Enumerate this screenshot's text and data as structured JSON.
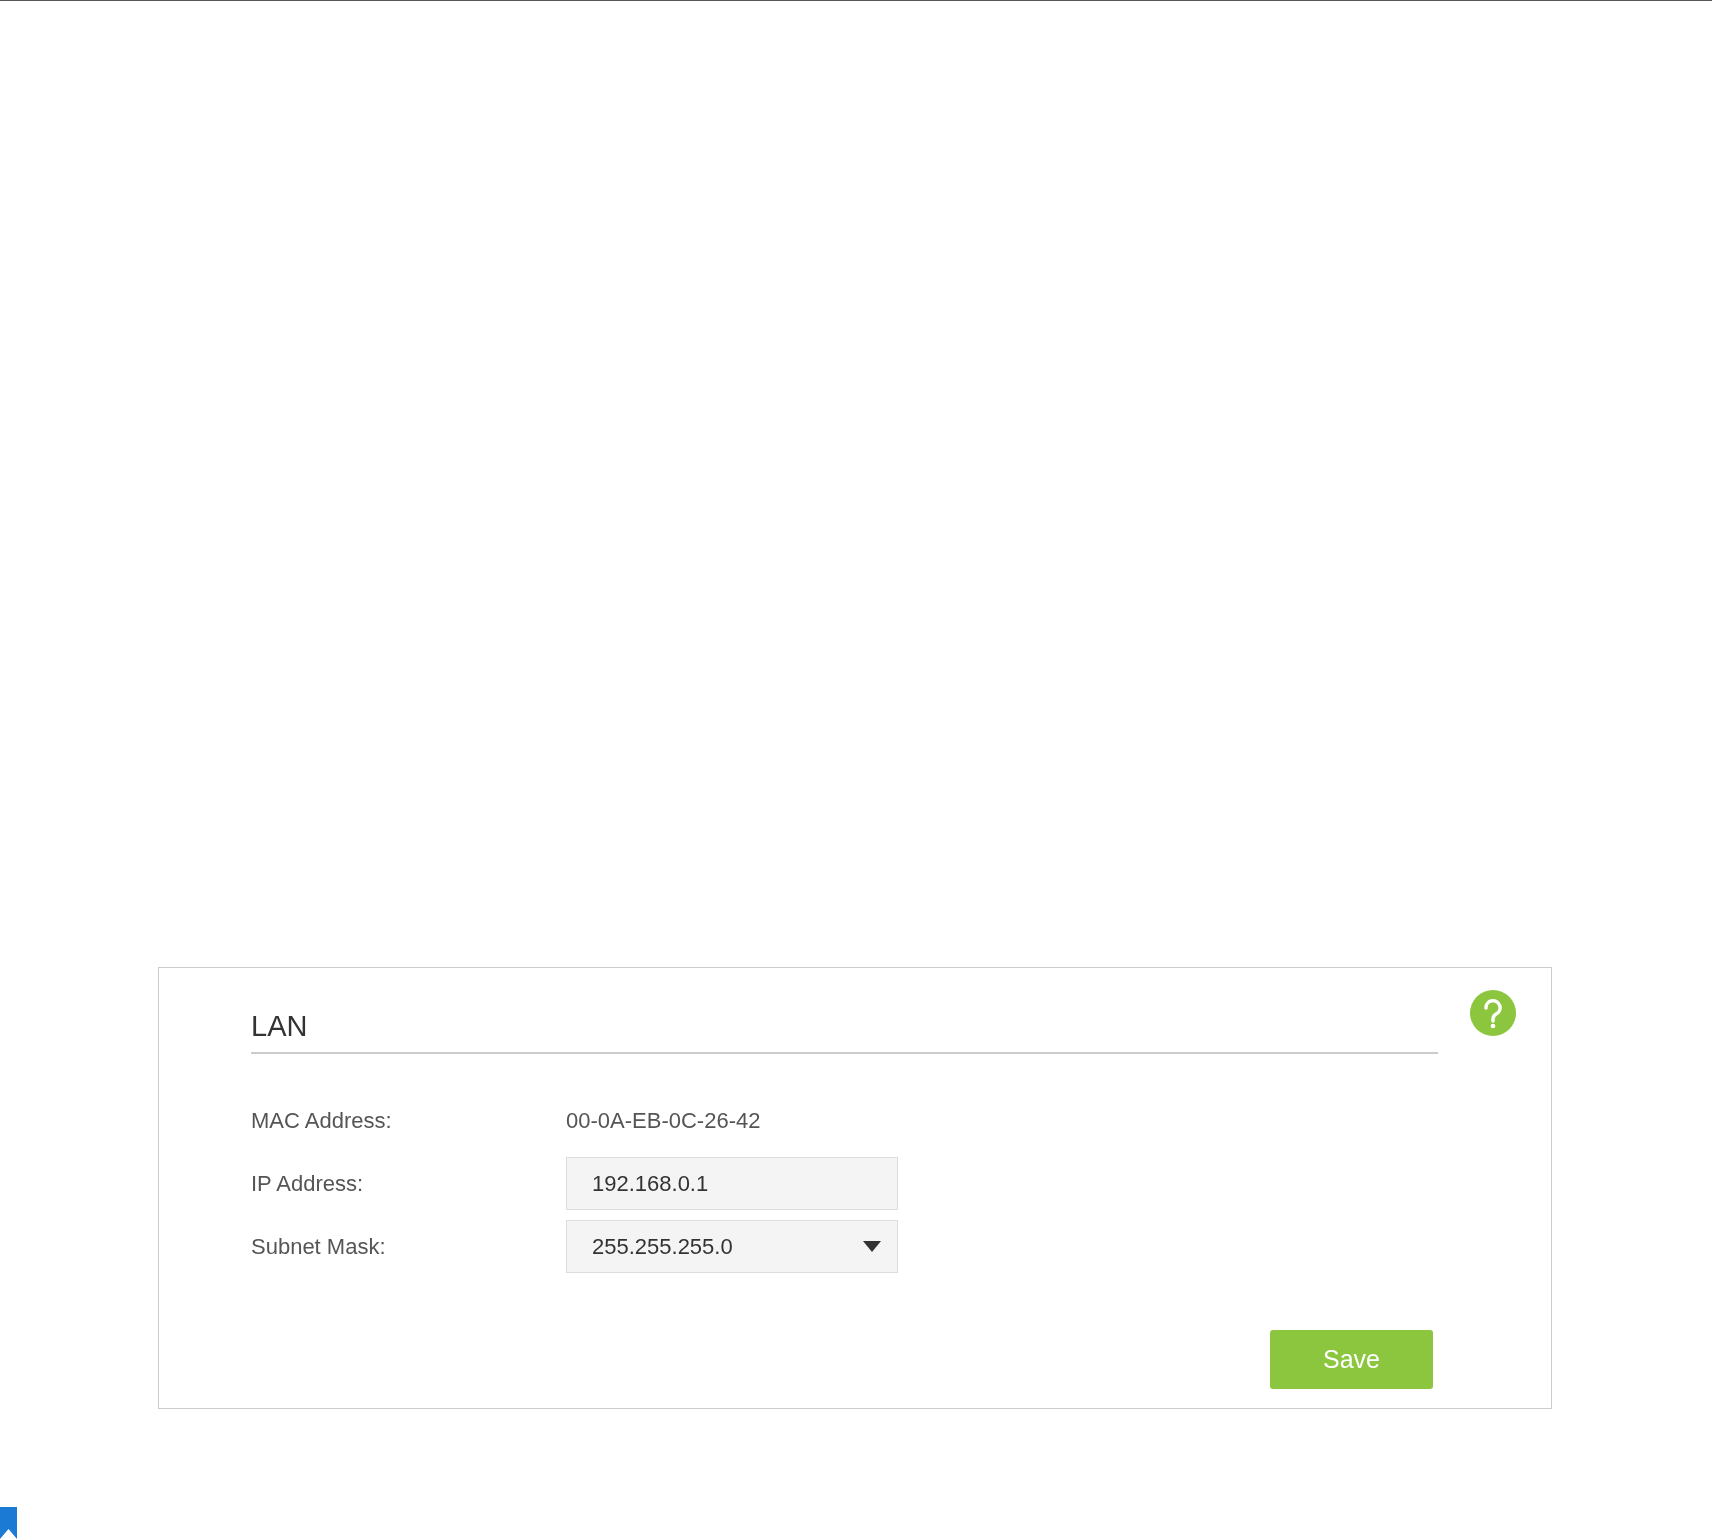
{
  "panel": {
    "title": "LAN",
    "fields": [
      {
        "kind": "text",
        "label": "MAC Address:",
        "value": "00-0A-EB-0C-26-42"
      },
      {
        "kind": "input",
        "label": "IP Address:",
        "value": "192.168.0.1"
      },
      {
        "kind": "select",
        "label": "Subnet Mask:",
        "value": "255.255.255.0"
      }
    ],
    "save_button": "Save"
  }
}
